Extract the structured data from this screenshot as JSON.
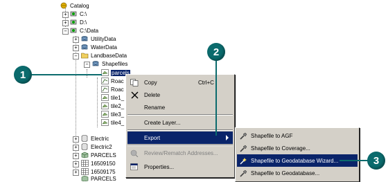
{
  "tree": {
    "catalog": "Catalog",
    "c_drive": "C:\\",
    "d_drive": "D:\\",
    "c_data": "C:\\Data",
    "utility": "UtilityData",
    "water": "WaterData",
    "landbase": "LandbaseData",
    "shapefiles": "Shapefiles",
    "parcels_sel": "parcels",
    "road1": "Roac",
    "road2": "Roac",
    "tile1": "tile1_",
    "tile2": "tile2_",
    "tile3": "tile3_",
    "tile4": "tile4_",
    "electric": "Electric",
    "electric2": "Electric2",
    "parcels": "PARCELS",
    "n1": "16509150",
    "n2": "16509175",
    "n3": "PARCELS"
  },
  "menu": {
    "copy": "Copy",
    "copy_shortcut": "Ctrl+C",
    "delete": "Delete",
    "rename": "Rename",
    "create_layer": "Create Layer...",
    "export": "Export",
    "review": "Review/Rematch Addresses...",
    "properties": "Properties..."
  },
  "submenu": {
    "agf": "Shapefile to AGF",
    "coverage": "Shapefile to Coverage...",
    "wizard": "Shapefile to Geodatabase Wizard...",
    "geodatabase": "Shapefile to Geodatabase..."
  },
  "callouts": {
    "c1": "1",
    "c2": "2",
    "c3": "3"
  },
  "colors": {
    "callout": "#0b6b6d",
    "highlight": "#0a246a",
    "menu_bg": "#d4d0c8"
  }
}
